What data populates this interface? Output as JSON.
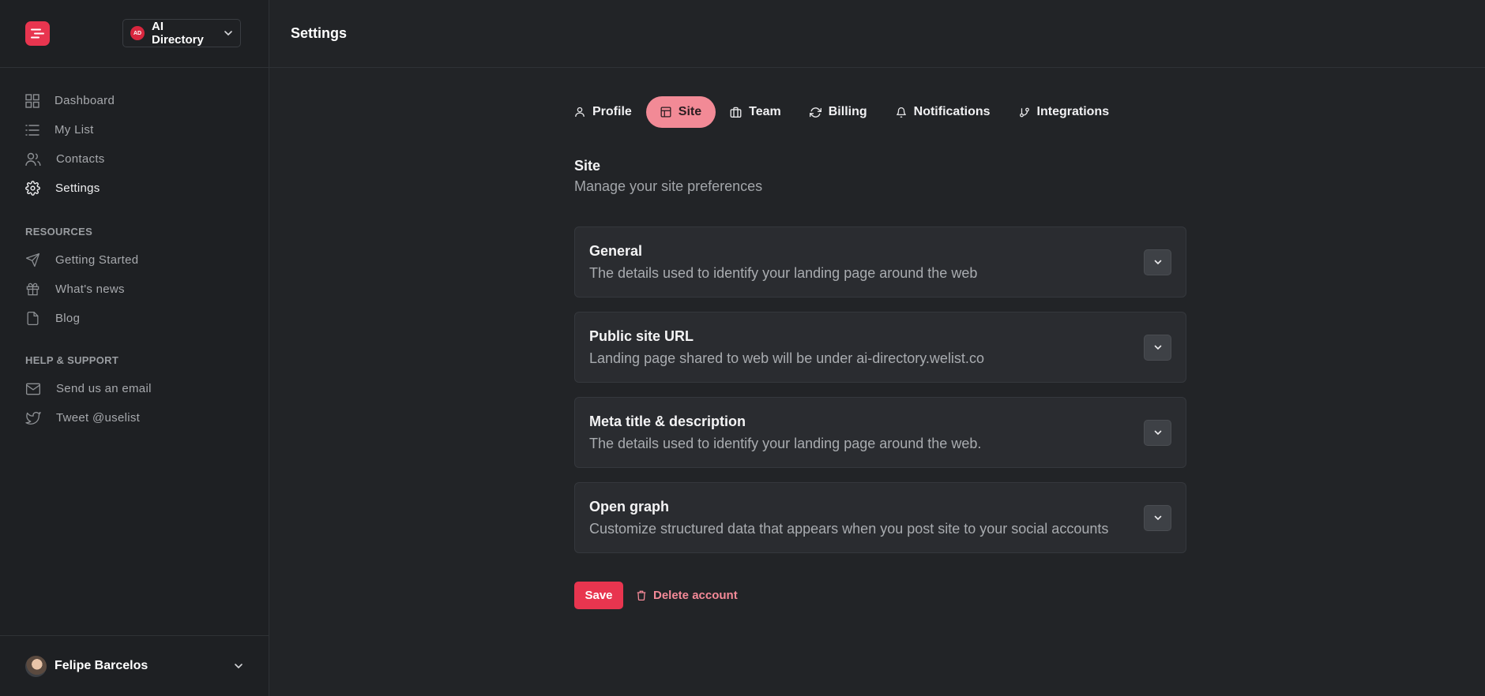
{
  "workspace": {
    "name": "AI Directory",
    "badge": "AD"
  },
  "header": {
    "title": "Settings"
  },
  "sidebar": {
    "nav": [
      {
        "label": "Dashboard",
        "icon": "grid-icon",
        "active": false
      },
      {
        "label": "My List",
        "icon": "list-icon",
        "active": false
      },
      {
        "label": "Contacts",
        "icon": "users-icon",
        "active": false
      },
      {
        "label": "Settings",
        "icon": "gear-icon",
        "active": true
      }
    ],
    "resources_label": "RESOURCES",
    "resources": [
      {
        "label": "Getting Started",
        "icon": "send-icon"
      },
      {
        "label": "What's news",
        "icon": "gift-icon"
      },
      {
        "label": "Blog",
        "icon": "file-icon"
      }
    ],
    "support_label": "HELP & SUPPORT",
    "support": [
      {
        "label": "Send us an email",
        "icon": "mail-icon"
      },
      {
        "label": "Tweet @uselist",
        "icon": "twitter-icon"
      }
    ],
    "user": {
      "name": "Felipe Barcelos"
    }
  },
  "tabs": [
    {
      "label": "Profile",
      "icon": "user-icon"
    },
    {
      "label": "Site",
      "icon": "layout-icon",
      "active": true
    },
    {
      "label": "Team",
      "icon": "briefcase-icon"
    },
    {
      "label": "Billing",
      "icon": "refresh-icon"
    },
    {
      "label": "Notifications",
      "icon": "bell-icon"
    },
    {
      "label": "Integrations",
      "icon": "git-branch-icon"
    }
  ],
  "section": {
    "title": "Site",
    "subtitle": "Manage your site preferences"
  },
  "cards": [
    {
      "title": "General",
      "description": "The details used to identify your landing page around the web"
    },
    {
      "title": "Public site URL",
      "description": "Landing page shared to web will be under ai-directory.welist.co"
    },
    {
      "title": "Meta title & description",
      "description": "The details used to identify your landing page around the web."
    },
    {
      "title": "Open graph",
      "description": "Customize structured data that appears when you post site to your social accounts"
    }
  ],
  "actions": {
    "save": "Save",
    "delete": "Delete account"
  },
  "colors": {
    "accent": "#e8354f",
    "active_tab": "#f28a96",
    "background": "#222427"
  }
}
